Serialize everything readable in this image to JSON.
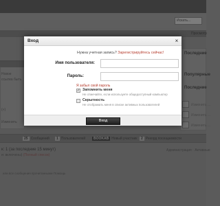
{
  "header": {
    "search_placeholder": "Искать...",
    "side_tab": "Просмотр"
  },
  "sidebar": {
    "blocks": [
      {
        "title": "Последние"
      },
      {
        "title": "Популярные"
      },
      {
        "title": "Последние"
      }
    ],
    "small_texts": [
      "Изменить ...",
      "Изменить ...",
      "Изменить ..."
    ]
  },
  "background": {
    "left_texts": [
      "Новое",
      "ссылка быть",
      "(»)",
      "Изменить"
    ]
  },
  "stats": {
    "messages": {
      "num": "25",
      "label": "Сообщений"
    },
    "users": {
      "num": "1",
      "label": "Пользователей"
    },
    "newest": {
      "num": "BOOKAB",
      "label": "Новый участник"
    },
    "record": {
      "num": "2",
      "label": "Рекорд посещаемости"
    }
  },
  "online": {
    "title": "к: 1 (за последние 15 минут)",
    "list_prefix": "и: включены)",
    "list_link": "(Полный список)",
    "admin_text": "Администрация · Активные",
    "footer_links": [
      "или все сообщения прочитанными",
      "Помощь"
    ]
  },
  "modal": {
    "title": "Вход",
    "close_symbol": "×",
    "register_prompt": "Нужна учетная запись?",
    "register_link": "Зарегистрируйтесь сейчас!",
    "username_label": "Имя пользователя:",
    "username_value": "",
    "password_label": "Пароль:",
    "password_value": "",
    "forgot_link": "Я забыл свой пароль",
    "remember_label": "Запомнить меня",
    "remember_checked": true,
    "remember_hint": "Не отмечайте, если используете общедоступный компьютер",
    "hidden_label": "Скрытность",
    "hidden_checked": false,
    "hidden_hint": "Не отображать меня в списке активных пользователей",
    "login_button": "Вход"
  }
}
